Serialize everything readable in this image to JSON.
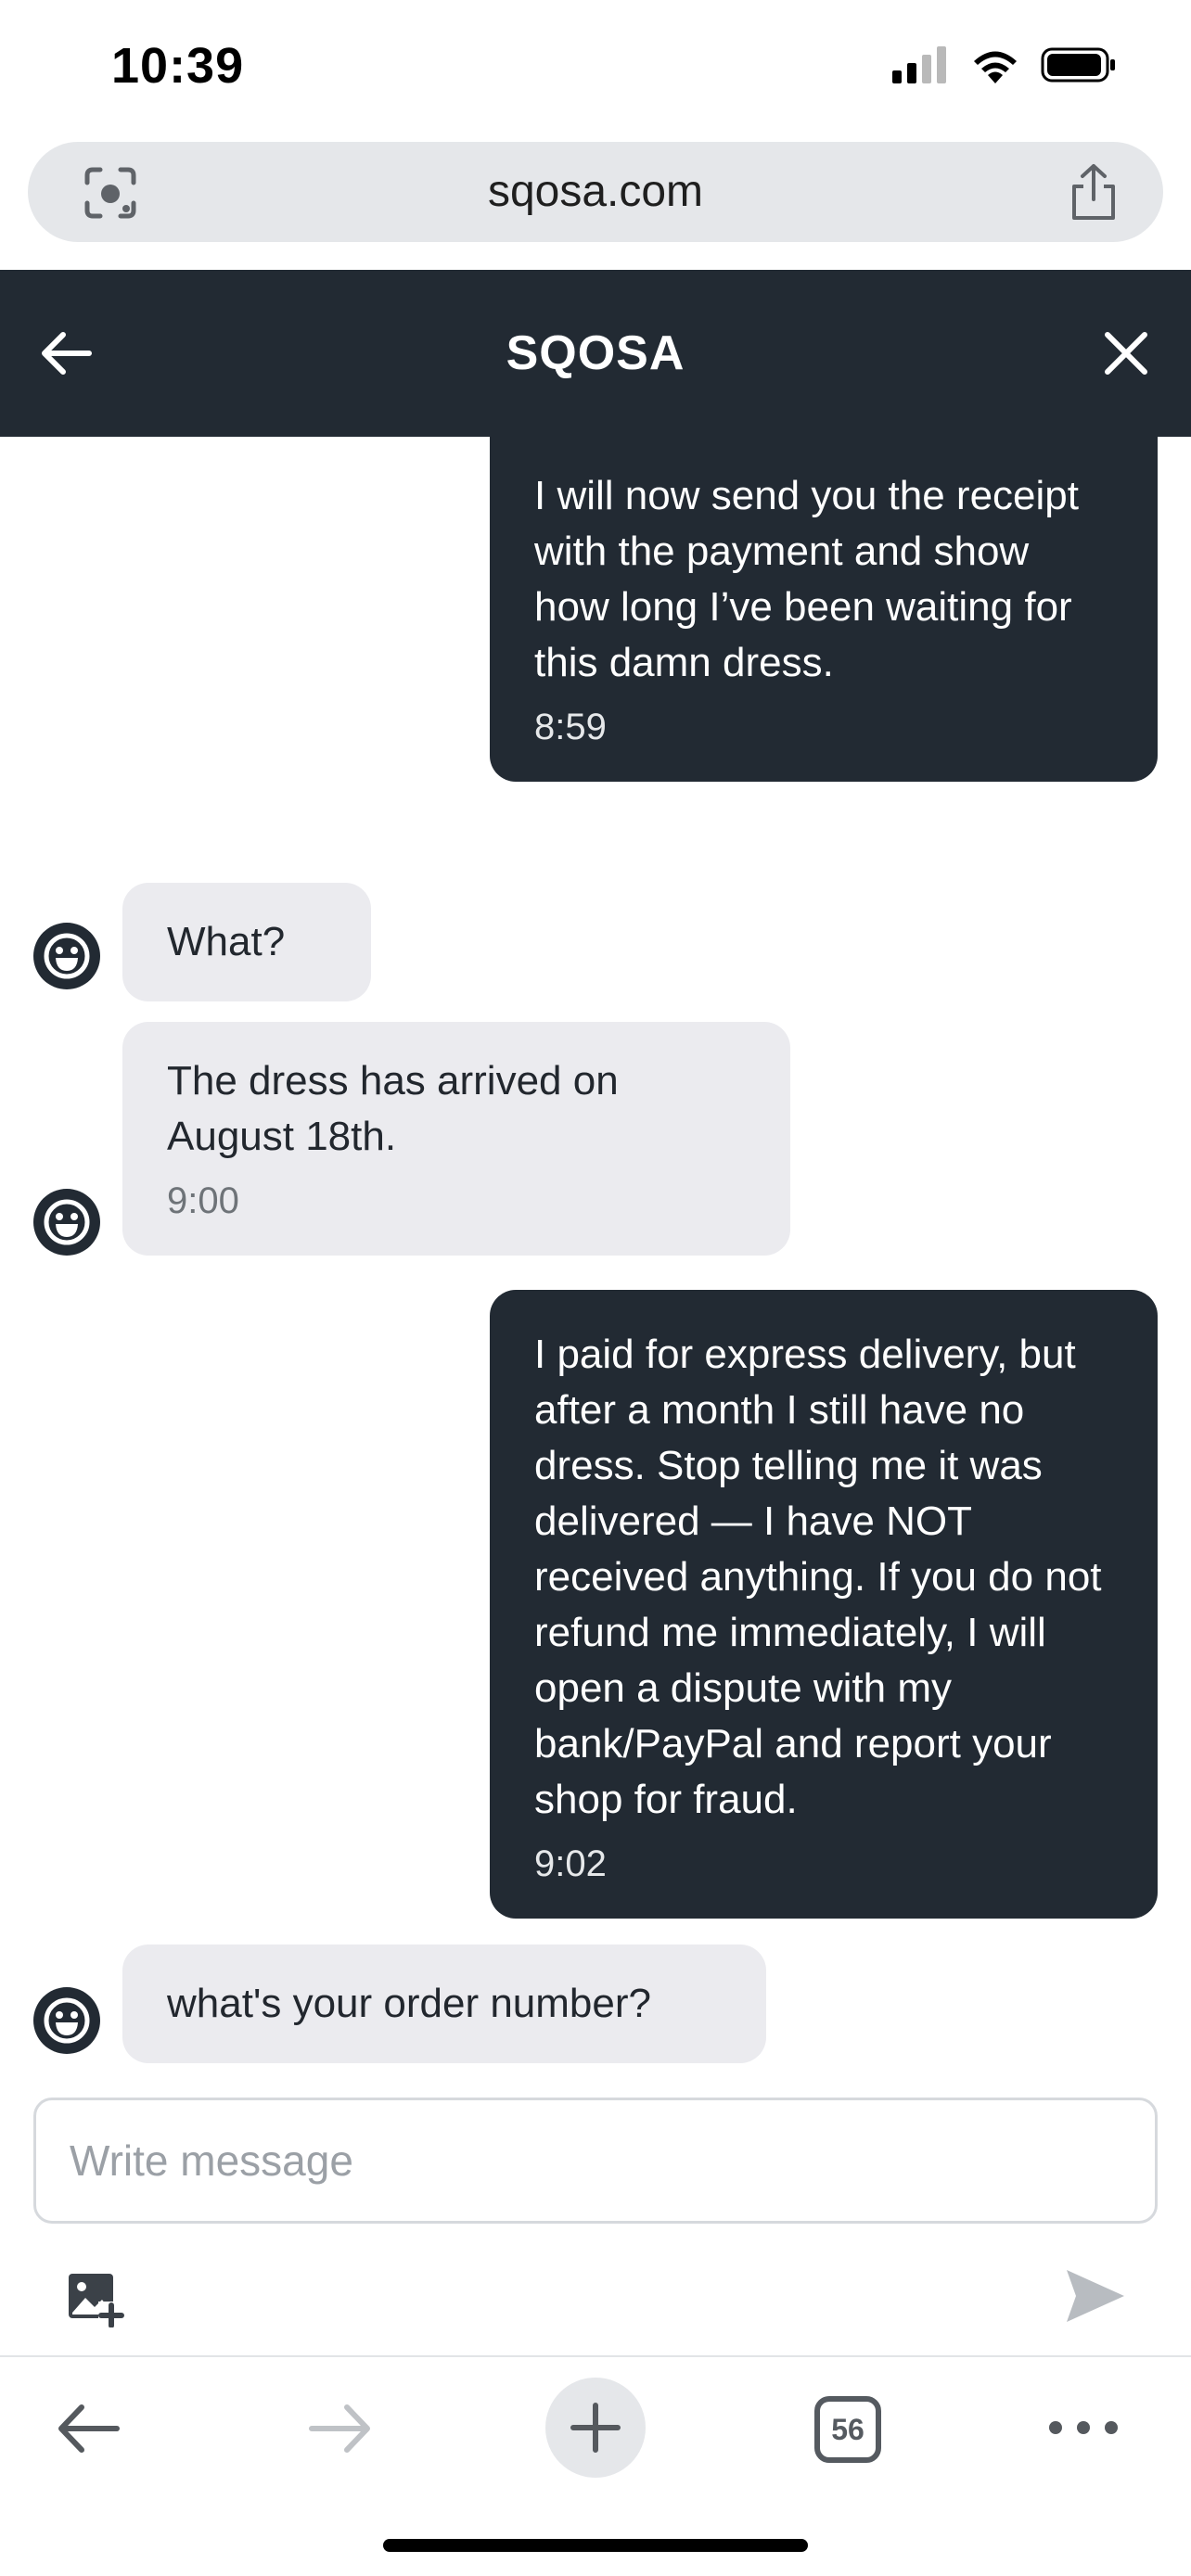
{
  "status_bar": {
    "time": "10:39"
  },
  "browser": {
    "url": "sqosa.com",
    "tab_count": "56"
  },
  "header": {
    "title": "SQOSA"
  },
  "messages": [
    {
      "side": "out",
      "text": "I will now send you the receipt with the payment and show how long I’ve been waiting for this damn dress.",
      "time": "8:59"
    },
    {
      "side": "in",
      "text": "What?",
      "time": ""
    },
    {
      "side": "in",
      "text": "The dress has arrived on August 18th.",
      "time": "9:00"
    },
    {
      "side": "out",
      "text": "I paid for express delivery, but after a month I still have no dress. Stop telling me it was delivered — I have NOT received anything. If you do not refund me immediately, I will open a dispute with my bank/PayPal and report your shop for fraud.",
      "time": "9:02"
    },
    {
      "side": "in",
      "text": "what's your order number?",
      "time": ""
    }
  ],
  "composer": {
    "placeholder": "Write message",
    "value": ""
  },
  "icons": {
    "lens": "lens-icon",
    "share": "share-icon",
    "back": "back-arrow-icon",
    "close": "close-icon",
    "avatar": "smiley-avatar-icon",
    "attach": "add-image-icon",
    "send": "send-icon",
    "nav_back": "back-icon",
    "nav_forward": "forward-icon",
    "new_tab": "plus-icon",
    "tabs": "tabs-icon",
    "more": "more-icon"
  },
  "colors": {
    "dark": "#222a33",
    "incoming_bubble": "#ebebef",
    "url_bar": "#e5e7ea"
  }
}
